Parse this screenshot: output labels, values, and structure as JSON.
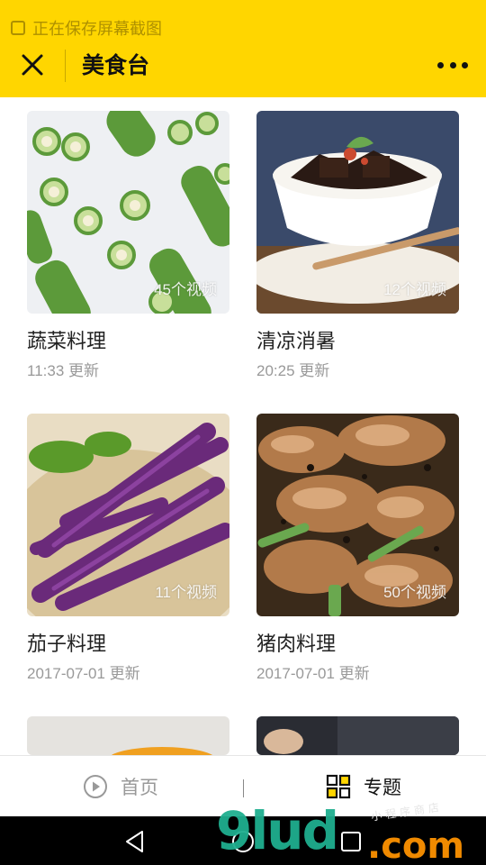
{
  "status_bar": {
    "text": "正在保存屏幕截图"
  },
  "header": {
    "title": "美食台",
    "close_icon": "close-icon",
    "more_icon": "more-horizontal-icon",
    "bg_color": "#FFD600"
  },
  "cards": [
    {
      "title": "蔬菜料理",
      "updated": "11:33 更新",
      "video_count": "45个视频",
      "image": "bitter-melon"
    },
    {
      "title": "清凉消暑",
      "updated": "20:25 更新",
      "video_count": "12个视频",
      "image": "grass-jelly-bowl"
    },
    {
      "title": "茄子料理",
      "updated": "2017-07-01 更新",
      "video_count": "11个视频",
      "image": "eggplants"
    },
    {
      "title": "猪肉料理",
      "updated": "2017-07-01 更新",
      "video_count": "50个视频",
      "image": "stir-fried-pork"
    }
  ],
  "tabbar": {
    "home_label": "首页",
    "topics_label": "专题",
    "home_icon": "play-circle-icon",
    "topics_icon": "grid-icon"
  },
  "watermark": {
    "main": "9lud",
    "suffix": ".com",
    "small": "小程序商店"
  },
  "colors": {
    "accent": "#FFD600",
    "muted_text": "#999999",
    "watermark_green": "#1fae8f",
    "watermark_orange": "#f08a00"
  }
}
